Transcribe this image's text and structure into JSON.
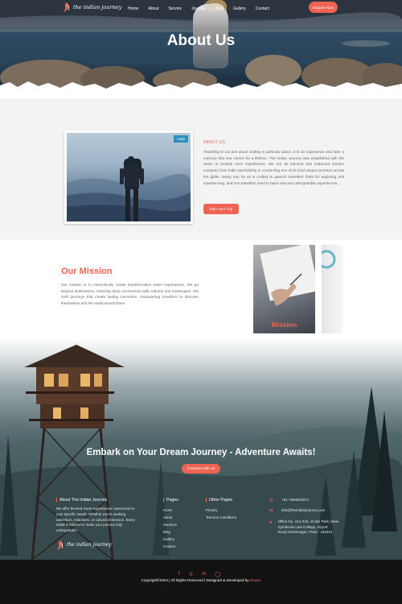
{
  "nav": {
    "logo_text": "the indian journey",
    "links": [
      "Home",
      "About",
      "Service",
      "Journey",
      "Blog",
      "Gallery",
      "Contact"
    ],
    "cta": "Enquire Now"
  },
  "hero": {
    "title": "About Us"
  },
  "about": {
    "image_tag": "India",
    "label": "ABOUT US",
    "text": "Travelling is not just about visiting a particular place, it is an experience and later a memory that one carries for a lifetime. The Indian Journey was established with the vision to provide such experiences. We are an inbound and outbound tourism company from India specializing in conducting one of its kind unique journeys across the globe. Every tour by us is crafted to quench travellers' thirst for exploring and experiencing, and non-travellers need to have new and unforgettable experiences...",
    "button": "Plan Your Trip"
  },
  "mission": {
    "title": "Our Mission",
    "text": "Our mission is to meticulously curate transformative travel experiences. We go beyond destinations, fostering deep connections with cultures and landscapes. We craft journeys that create lasting memories, empowering travellers to discover themselves and the world around them.",
    "card_label": "Mission"
  },
  "cta": {
    "title": "Embark on Your Dream Journey - Adventure Awaits!",
    "button": "Connect with us"
  },
  "footer": {
    "about_head": "About The Indian Journey",
    "about_text": "We offer themed travel experiences customized to your specific needs. Whether you're seeking adventure, relaxation, or cultural immersion. Every detail is tailored to make your journey truly unforgettable.",
    "logo_text": "the indian journey",
    "pages_head": "Pages",
    "pages": [
      "Home",
      "About",
      "Services",
      "Blog",
      "Gallery",
      "Contact"
    ],
    "other_head": "Other Pages",
    "other_pages": [
      "Privacy",
      "Terms & Conditions"
    ],
    "phone": "+91 7666601972",
    "email": "info@theindianjourney.com",
    "address": "Office No. 214-216, 10 Biz Park, Near Symbiosis Law College, Airport Road,Vimannagar, Pune - 411014",
    "copyright": "Copyright©2024 | All Rights Reserved | Designed & Developed by ",
    "developer": "Diwise"
  },
  "colors": {
    "accent": "#ef6352",
    "tag": "#2b8fc0"
  }
}
